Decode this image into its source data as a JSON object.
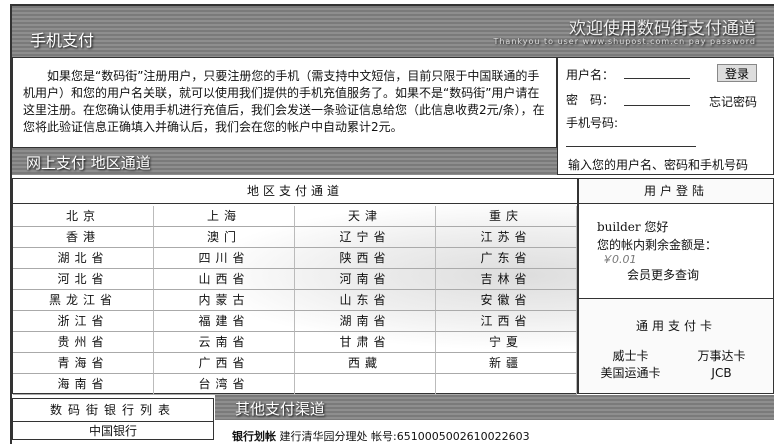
{
  "header": {
    "title": "手机支付",
    "welcome": "欢迎使用数码街支付通道",
    "subtitle": "Thankyou to user www.shupost.com.cn pay password"
  },
  "intro": "如果您是“数码街”注册用户，只要注册您的手机（需支持中文短信，目前只限于中国联通的手机用户）和您的用户名关联，就可以使用我们提供的手机充值服务了。如果不是“数码街”用户请在这里注册。在您确认使用手机进行充值后，我们会发送一条验证信息给您（此信息收费2元/条），在您将此验证信息正确填入并确认后，我们会在您的帐户中自动累计2元。",
  "login": {
    "username_label": "用户名：",
    "password_label": "密　码：",
    "phone_label": "手机号码:",
    "login_button": "登录",
    "forgot": "忘记密码",
    "hint": "输入您的用户名、密码和手机号码"
  },
  "online": {
    "title": "网上支付  地区通道",
    "region_header": "地区支付通道",
    "regions": [
      "北京",
      "上海",
      "天津",
      "重庆",
      "香港",
      "澳门",
      "辽宁省",
      "江苏省",
      "湖北省",
      "四川省",
      "陕西省",
      "广东省",
      "河北省",
      "山西省",
      "河南省",
      "吉林省",
      "黑龙江省",
      "内蒙古",
      "山东省",
      "安徽省",
      "浙江省",
      "福建省",
      "湖南省",
      "江西省",
      "贵州省",
      "云南省",
      "甘肃省",
      "宁夏",
      "青海省",
      "广西省",
      "西藏",
      "新疆",
      "海南省",
      "台湾省",
      "",
      ""
    ]
  },
  "account": {
    "header": "用户登陆",
    "greeting": "builder 您好",
    "balance_label": "您的帐内剩余金额是：",
    "balance": "￥0.01",
    "more": "会员更多查询"
  },
  "cards": {
    "header": "通用支付卡",
    "items": [
      "威士卡",
      "万事达卡",
      "美国运通卡",
      "JCB"
    ]
  },
  "banklist": {
    "header": "数码街银行列表",
    "items": [
      "中国银行"
    ]
  },
  "other": {
    "title": "其他支付渠道",
    "label": "银行划帐",
    "text": "建行清华园分理处 帐号:6510005002610022603"
  }
}
